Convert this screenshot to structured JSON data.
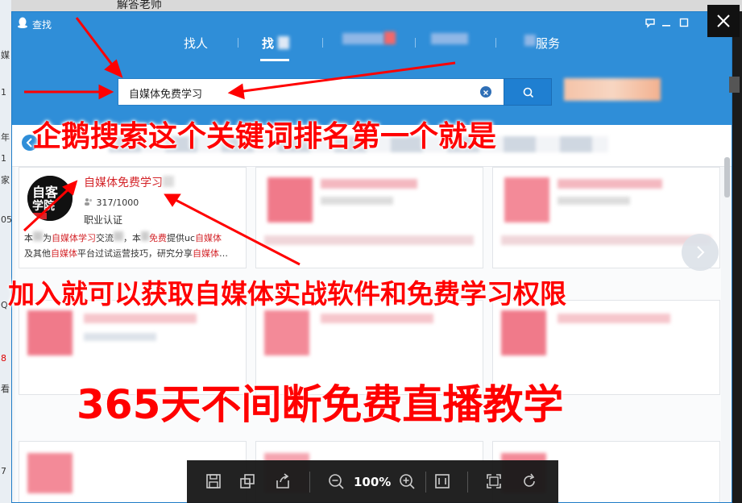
{
  "behind": {
    "top_text": "解答老师",
    "left_glyphs": [
      "媒",
      "1",
      "年",
      "1",
      "家",
      "05",
      "Q",
      "8",
      "看",
      "7"
    ]
  },
  "window": {
    "title": "查找",
    "tabs": [
      {
        "label": "找人",
        "active": false
      },
      {
        "label": "找",
        "active": true
      },
      {
        "label": "服务",
        "active": false
      }
    ]
  },
  "search": {
    "value": "自媒体免费学习",
    "clear_icon": "clear-circle-icon",
    "button_icon": "search-icon"
  },
  "result": {
    "title": "自媒体免费学习",
    "member_count": "317/1000",
    "certification": "职业认证",
    "description_parts": [
      "本",
      "为",
      "自媒体学习",
      "交流",
      "，本",
      "免费",
      "提供uc",
      "自媒体",
      "及其他",
      "自媒体",
      "平台过试运营技巧，研究分享",
      "自媒体",
      "…"
    ]
  },
  "overlay": {
    "headline1": "企鹅搜索这个关键词排名第一个就是",
    "headline2": "加入就可以获取自媒体实战软件和免费学习权限",
    "headline3": "365天不间断免费直播教学"
  },
  "viewer": {
    "zoom": "100%",
    "icons": [
      "save-icon",
      "copy-icon",
      "share-icon",
      "zoom-out-icon",
      "zoom-in-icon",
      "original-size-icon",
      "fit-screen-icon",
      "rotate-icon"
    ]
  },
  "colors": {
    "header_blue": "#2f8ed8",
    "annotation_red": "#ff0000",
    "highlight_red": "#d4252a"
  }
}
